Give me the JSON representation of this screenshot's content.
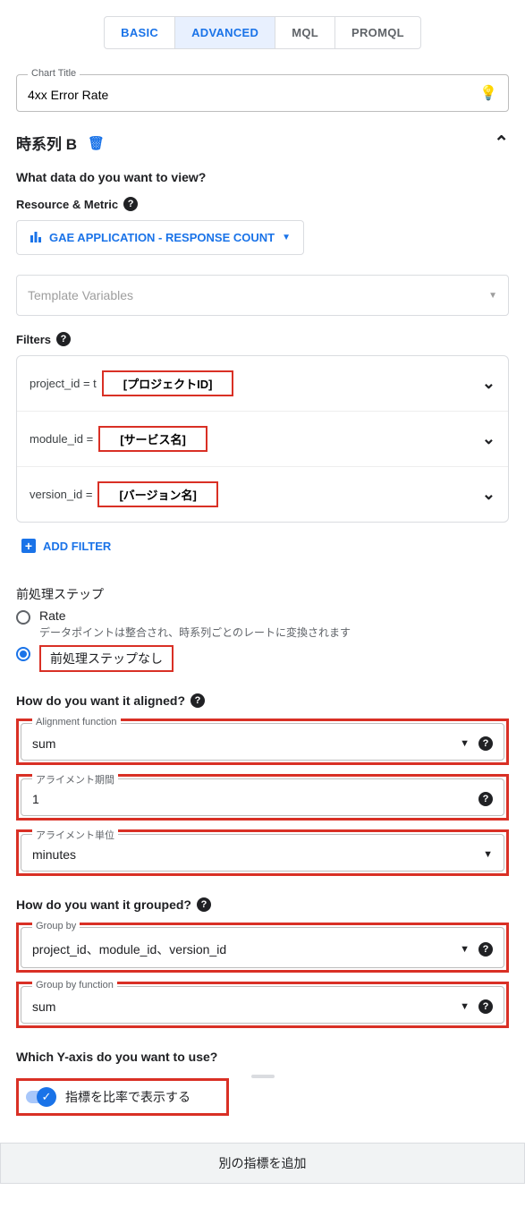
{
  "tabs": {
    "basic": "BASIC",
    "advanced": "ADVANCED",
    "mql": "MQL",
    "promql": "PROMQL"
  },
  "chartTitle": {
    "legend": "Chart Title",
    "value": "4xx Error Rate"
  },
  "series": {
    "title": "時系列 B"
  },
  "q_what_data": "What data do you want to view?",
  "resource_metric": {
    "label": "Resource & Metric",
    "chip": "GAE APPLICATION - RESPONSE COUNT"
  },
  "template_vars": "Template Variables",
  "filters": {
    "label": "Filters",
    "rows": [
      {
        "key": "project_id = t",
        "badge": "[プロジェクトID]"
      },
      {
        "key": "module_id =",
        "badge": "[サービス名]"
      },
      {
        "key": "version_id =",
        "badge": "[バージョン名]"
      }
    ],
    "add": "ADD FILTER"
  },
  "preproc": {
    "title": "前処理ステップ",
    "rate": {
      "label": "Rate",
      "desc": "データポイントは整合され、時系列ごとのレートに変換されます"
    },
    "none": {
      "label": "前処理ステップなし"
    }
  },
  "aligned": {
    "title": "How do you want it aligned?",
    "fn": {
      "legend": "Alignment function",
      "value": "sum"
    },
    "period": {
      "legend": "アライメント期間",
      "value": "1"
    },
    "unit": {
      "legend": "アライメント単位",
      "value": "minutes"
    }
  },
  "grouped": {
    "title": "How do you want it grouped?",
    "by": {
      "legend": "Group by",
      "value": "project_id、module_id、version_id"
    },
    "fn": {
      "legend": "Group by function",
      "value": "sum"
    }
  },
  "yaxis": {
    "title": "Which Y-axis do you want to use?",
    "toggle": "指標を比率で表示する"
  },
  "bottom_button": "別の指標を追加"
}
